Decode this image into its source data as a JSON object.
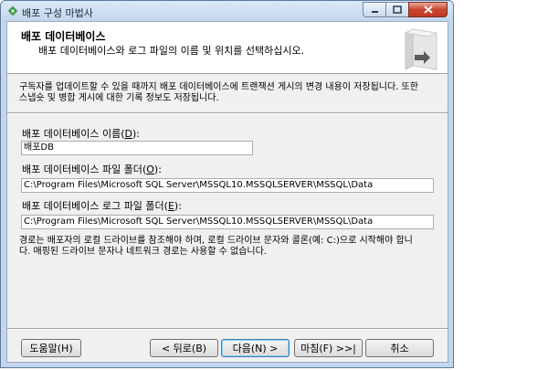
{
  "window": {
    "title": "배포 구성 마법사",
    "header_title": "배포 데이터베이스",
    "header_subtitle": "배포 데이터베이스와 로그 파일의 이름 및 위치를 선택하십시오."
  },
  "description": {
    "line1": "구독자를 업데이트할 수 있을 때까지 배포 데이터베이스에 트랜잭션 게시의 변경 내용이 저장됩니다. 또한",
    "line2": "스냅숏 및 병합 게시에 대한 기록 정보도 저장됩니다."
  },
  "fields": {
    "db_name": {
      "label": "배포 데이터베이스 이름",
      "key": "D",
      "value": "배포DB"
    },
    "data_folder": {
      "label": "배포 데이터베이스 파일 폴더",
      "key": "O",
      "value": "C:\\Program Files\\Microsoft SQL Server\\MSSQL10.MSSQLSERVER\\MSSQL\\Data"
    },
    "log_folder": {
      "label": "배포 데이터베이스 로그 파일 폴더",
      "key": "E",
      "value": "C:\\Program Files\\Microsoft SQL Server\\MSSQL10.MSSQLSERVER\\MSSQL\\Data"
    }
  },
  "note": {
    "line1": "경로는 배포자의 로컬 드라이브를 참조해야 하며, 로컬 드라이브 문자와 콜론(예: C:)으로 시작해야 합니",
    "line2": "다. 매핑된 드라이브 문자나 네트워크 경로는 사용할 수 없습니다."
  },
  "buttons": {
    "help": "도움말(H)",
    "back": "< 뒤로(B)",
    "next": "다음(N) >",
    "finish": "마침(F) >>|",
    "cancel": "취소"
  },
  "colors": {
    "accent_default": "#3c7fb1",
    "close_red": "#c8452f"
  }
}
